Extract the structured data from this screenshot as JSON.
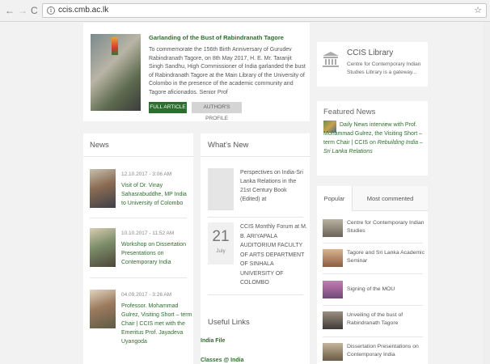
{
  "browser": {
    "url": "ccis.cmb.ac.lk"
  },
  "featured": {
    "title": "Garlanding of the Bust of Rabindranath Tagore",
    "body": "To commemorate the 156th Birth Anniversary of Gurudev Rabindranath Tagore, on 8th May 2017, H. E. Mr. Taranjit Singh Sandhu, High Commissioner of India garlanded the bust of Rabindranath Tagore at the Main Library of the University of Colombo in the presence of the academic community and Tagore aficionados. Senior Prof",
    "full_article": "FULL ARTICLE",
    "author_profile": "AUTHOR'S PROFILE"
  },
  "library": {
    "title": "CCIS Library",
    "description": "Centre for Contemporary Indian Studies Library is a gateway..."
  },
  "featured_news": {
    "title": "Featured News",
    "text_before": "Daily News interview with Prof. Mohammad Gulrez, the Visiting Short – term Chair | CCIS on ",
    "text_italic": "Rebuilding India – Sri Lanka Relations"
  },
  "news": {
    "title": "News",
    "items": [
      {
        "date": "12.10.2017 - 3:06 AM",
        "text": "Visit of Dr. Vinay Sahasrabuddhe, MP India to University of Colombo"
      },
      {
        "date": "10.10.2017 - 11:52 AM",
        "text": "Workshop on Dissertation Presentations on Contemporary India"
      },
      {
        "date": "04.09.2017 - 3:26 AM",
        "text": "Professor. Mohammad Gulrez, Visiting Short – term Chair | CCIS met with the Emeritus Prof. Jayadeva Uyangoda"
      }
    ]
  },
  "whats_new": {
    "title": "What's New",
    "item1": "Perspectives on India-Sri Lanka Relations in the 21st Century Book (Edited) at",
    "date_day": "21",
    "date_month": "July",
    "item2": "CCIS Monthly Forum at M. B. ARIYAPALA AUDITORIUM FACULTY OF ARTS DEPARTMENT OF SINHALA UNIVERSITY OF COLOMBO",
    "useful_links_title": "Useful Links",
    "links": [
      "India File",
      "Classes @ India"
    ]
  },
  "tabs": {
    "popular": "Popular",
    "most_commented": "Most commented",
    "items": [
      "Centre for Contemporary Indian Studies",
      "Tagore and Sri Lanka Academic Seminar",
      "Signing of the MOU",
      "Unveiling of the bust of Rabindranath Tagore",
      "Dissertation Presentations on Contemporary India"
    ]
  }
}
